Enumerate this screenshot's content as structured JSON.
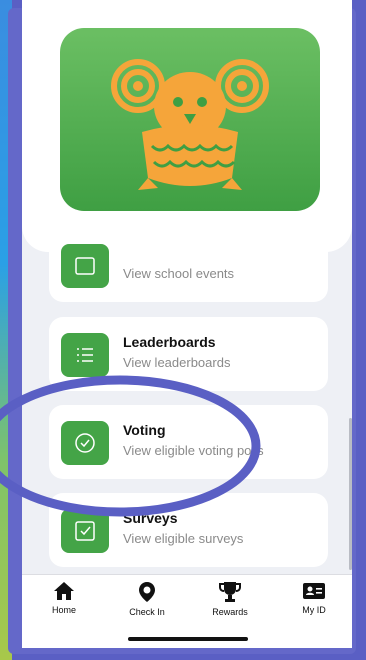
{
  "brand": {
    "logo": "owl-logo",
    "accent": "#44a447",
    "logo_color": "#f5a53a"
  },
  "menu": {
    "items": [
      {
        "title": "",
        "subtitle": "View school events",
        "icon": "calendar-icon"
      },
      {
        "title": "Leaderboards",
        "subtitle": "View leaderboards",
        "icon": "list-icon"
      },
      {
        "title": "Voting",
        "subtitle": "View eligible voting polls",
        "icon": "check-circle-icon"
      },
      {
        "title": "Surveys",
        "subtitle": "View eligible surveys",
        "icon": "checkbox-icon"
      }
    ]
  },
  "tabs": [
    {
      "label": "Home",
      "icon": "home-icon"
    },
    {
      "label": "Check In",
      "icon": "location-pin-icon"
    },
    {
      "label": "Rewards",
      "icon": "trophy-icon"
    },
    {
      "label": "My ID",
      "icon": "id-card-icon"
    }
  ],
  "annotation": {
    "shape": "ellipse",
    "color": "#5a5fc4"
  }
}
